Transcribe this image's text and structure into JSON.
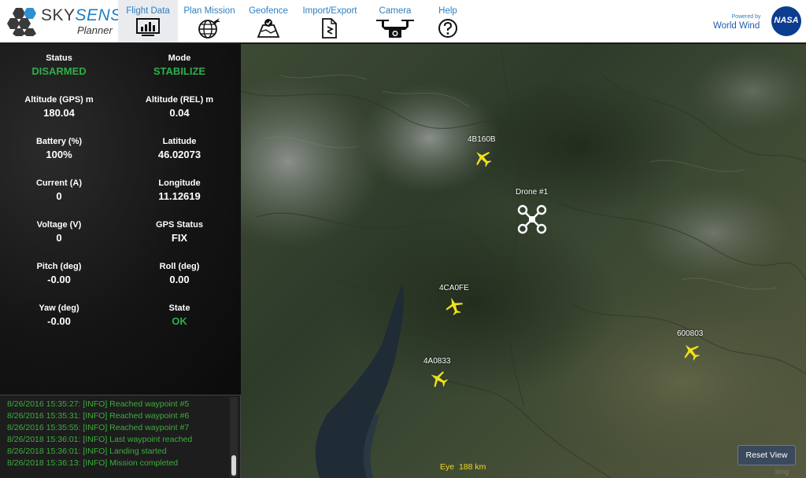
{
  "app": {
    "brand_sky": "SKY",
    "brand_sense": "SENSE",
    "brand_sub": "Planner"
  },
  "nav": {
    "tabs": [
      {
        "label": "Flight Data",
        "icon": "chart-monitor-icon",
        "active": true
      },
      {
        "label": "Plan Mission",
        "icon": "globe-plane-icon",
        "active": false
      },
      {
        "label": "Geofence",
        "icon": "map-check-icon",
        "active": false
      },
      {
        "label": "Import/Export",
        "icon": "file-arrows-icon",
        "active": false
      },
      {
        "label": "Camera",
        "icon": "drone-camera-icon",
        "active": false
      },
      {
        "label": "Help",
        "icon": "question-circle-icon",
        "active": false
      }
    ]
  },
  "worldwind": {
    "powered_by": "Powered by",
    "name": "World Wind",
    "nasa": "NASA"
  },
  "telemetry": [
    {
      "label": "Status",
      "value": "DISARMED",
      "green": true
    },
    {
      "label": "Mode",
      "value": "STABILIZE",
      "green": true
    },
    {
      "label": "Altitude (GPS) m",
      "value": "180.04",
      "green": false
    },
    {
      "label": "Altitude (REL) m",
      "value": "0.04",
      "green": false
    },
    {
      "label": "Battery (%)",
      "value": "100%",
      "green": false
    },
    {
      "label": "Latitude",
      "value": "46.02073",
      "green": false
    },
    {
      "label": "Current (A)",
      "value": "0",
      "green": false
    },
    {
      "label": "Longitude",
      "value": "11.12619",
      "green": false
    },
    {
      "label": "Voltage (V)",
      "value": "0",
      "green": false
    },
    {
      "label": "GPS Status",
      "value": "FIX",
      "green": false
    },
    {
      "label": "Pitch (deg)",
      "value": "-0.00",
      "green": false
    },
    {
      "label": "Roll (deg)",
      "value": "0.00",
      "green": false
    },
    {
      "label": "Yaw (deg)",
      "value": "-0.00",
      "green": false
    },
    {
      "label": "State",
      "value": "OK",
      "green": true
    }
  ],
  "log": [
    "8/26/2016 15:35:27: [INFO] Reached waypoint #5",
    "8/26/2016 15:35:31: [INFO] Reached waypoint #6",
    "8/26/2016 15:35:55: [INFO] Reached waypoint #7",
    "8/26/2018 15:36:01: [INFO] Last waypoint reached",
    "8/26/2018 15:36:01: [INFO] Landing started",
    "8/26/2018 15:36:13: [INFO] Mission completed"
  ],
  "map": {
    "aircraft": [
      {
        "label": "4B160B"
      },
      {
        "label": "4CA0FE"
      },
      {
        "label": "4A0833"
      },
      {
        "label": "600803"
      }
    ],
    "drone_label": "Drone #1",
    "eye_label": "Eye",
    "eye_value": "188 km",
    "reset_label": "Reset View",
    "attribution": "bing",
    "aircraft_color": "#f2e21a"
  }
}
